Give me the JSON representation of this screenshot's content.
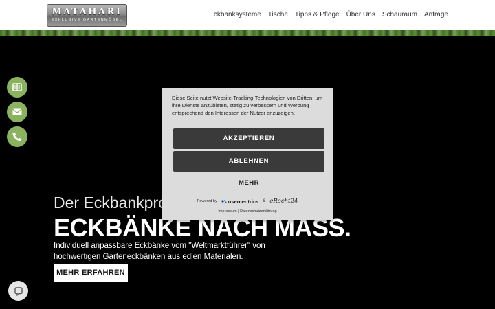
{
  "header": {
    "logo_title": "MATAHARI",
    "logo_subtitle": "EXKLUSIVE GARTENMÖBEL",
    "nav": [
      "Eckbanksysteme",
      "Tische",
      "Tipps & Pflege",
      "Über Uns",
      "Schauraum",
      "Anfrage"
    ]
  },
  "side_buttons": {
    "icons": [
      "book-icon",
      "mail-icon",
      "phone-icon"
    ],
    "color": "#8bb35f"
  },
  "hero": {
    "subtitle": "Der Eckbankprofi",
    "title": "ECKBÄNKE NACH MASS.",
    "description": "Individuell anpassbare Eckbänke vom \"Weltmarktführer\" von hochwertigen Garteneckbänken aus edlen Materialen.",
    "button_label": "MEHR ERFAHREN"
  },
  "consent": {
    "text": "Diese Seite nutzt Website-Tracking-Technologien von Dritten, um ihre Dienste anzubieten, stetig zu verbessern und Werbung entsprechend den Interessen der Nutzer anzuzeigen.",
    "accept_label": "AKZEPTIEREN",
    "decline_label": "ABLEHNEN",
    "more_label": "MEHR",
    "powered_by": "Powered by",
    "provider1": "usercentrics",
    "ampersand": "&",
    "provider2": "eRecht24",
    "links": "Impressum | Datenschutzerklärung"
  },
  "chat": {
    "icon": "chat-icon"
  }
}
